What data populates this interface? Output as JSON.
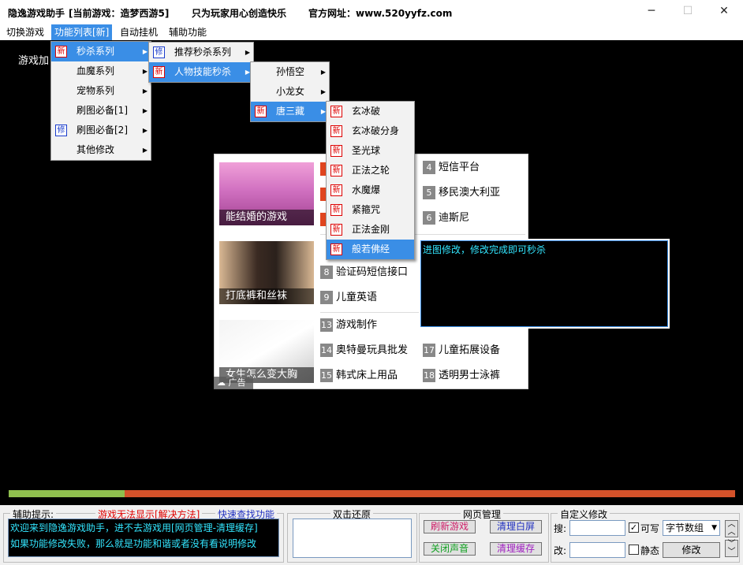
{
  "window": {
    "title_app": "隐逸游戏助手",
    "title_game": "[当前游戏：造梦西游5]",
    "title_slogan": "只为玩家用心创造快乐",
    "title_site": "官方网址：www.520yyfz.com"
  },
  "menubar": {
    "items": [
      "切换游戏",
      "功能列表[新]",
      "自动挂机",
      "辅助功能"
    ]
  },
  "game": {
    "overlay_text": "游戏加"
  },
  "menu1": {
    "items": [
      {
        "label": "秒杀系列",
        "badge": "新",
        "badge_color": "red",
        "highlight": true
      },
      {
        "label": "血魔系列",
        "badge": "",
        "highlight": false
      },
      {
        "label": "宠物系列",
        "badge": "",
        "highlight": false
      },
      {
        "label": "刷图必备[1]",
        "badge": "",
        "highlight": false
      },
      {
        "label": "刷图必备[2]",
        "badge": "修",
        "badge_color": "blue",
        "highlight": false
      },
      {
        "label": "其他修改",
        "badge": "",
        "highlight": false
      }
    ]
  },
  "menu2": {
    "items": [
      {
        "label": "推荐秒杀系列",
        "badge": "修",
        "badge_color": "blue",
        "highlight": false
      },
      {
        "label": "人物技能秒杀",
        "badge": "新",
        "badge_color": "red",
        "highlight": true
      }
    ]
  },
  "menu3": {
    "items": [
      {
        "label": "孙悟空",
        "badge": "",
        "highlight": false
      },
      {
        "label": "小龙女",
        "badge": "",
        "highlight": false
      },
      {
        "label": "唐三藏",
        "badge": "新",
        "badge_color": "red",
        "highlight": true
      }
    ]
  },
  "menu4": {
    "items": [
      {
        "label": "玄冰破",
        "badge": "新",
        "highlight": false
      },
      {
        "label": "玄冰破分身",
        "badge": "新",
        "highlight": false
      },
      {
        "label": "圣光球",
        "badge": "新",
        "highlight": false
      },
      {
        "label": "正法之轮",
        "badge": "新",
        "highlight": false
      },
      {
        "label": "水魔爆",
        "badge": "新",
        "highlight": false
      },
      {
        "label": "紧箍咒",
        "badge": "新",
        "highlight": false
      },
      {
        "label": "正法金刚",
        "badge": "新",
        "highlight": false
      },
      {
        "label": "般若佛经",
        "badge": "新",
        "highlight": true
      }
    ]
  },
  "ad": {
    "images": [
      "能结婚的游戏",
      "打底裤和丝袜",
      "女生怎么变大胸"
    ],
    "links": [
      {
        "num": "4",
        "text": "短信平台"
      },
      {
        "num": "5",
        "text": "移民澳大利亚"
      },
      {
        "num": "6",
        "text": "迪斯尼"
      },
      {
        "num": "8",
        "text": "验证码短信接口"
      },
      {
        "num": "9",
        "text": "儿童英语"
      },
      {
        "num": "13",
        "text": "游戏制作"
      },
      {
        "num": "14",
        "text": "奥特曼玩具批发"
      },
      {
        "num": "17",
        "text": "儿童拓展设备"
      },
      {
        "num": "15",
        "text": "韩式床上用品"
      },
      {
        "num": "18",
        "text": "透明男士泳裤"
      }
    ],
    "mark": "广告"
  },
  "info_box": {
    "text": "进图修改，修改完成即可秒杀"
  },
  "progress": {
    "value": 0.16
  },
  "bottom": {
    "tips": {
      "title": "辅助提示:",
      "link1": "游戏无法显示[解决方法]",
      "link2": "快速查找功能",
      "line1": "欢迎来到隐逸游戏助手，进不去游戏用[网页管理-清理缓存]",
      "line2": "如果功能修改失败，那么就是功能和谐或者没有看说明修改"
    },
    "restore": {
      "title": "双击还原"
    },
    "web": {
      "title": "网页管理",
      "refresh": "刷新游戏",
      "clear_white": "清理白屏",
      "mute": "关闭声音",
      "clear_cache": "清理缓存"
    },
    "custom": {
      "title": "自定义修改",
      "search_label": "搜:",
      "change_label": "改:",
      "writable_label": "可写",
      "static_label": "静态",
      "type_value": "字节数组",
      "modify_button": "修改"
    }
  }
}
